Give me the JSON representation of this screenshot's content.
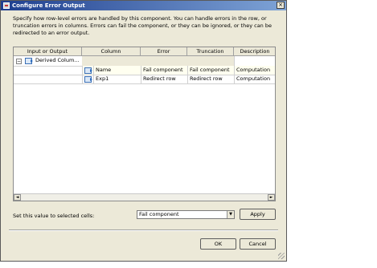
{
  "window": {
    "title": "Configure Error Output",
    "close_glyph": "×"
  },
  "description": "Specify how row-level errors are handled by this component. You can handle errors in the row, or truncation errors in columns. Errors can fail the component, or they can be ignored, or they can be redirected to an error output.",
  "grid": {
    "columns": [
      "Input or Output",
      "Column",
      "Error",
      "Truncation",
      "Description"
    ],
    "parent_row": {
      "expander": "−",
      "label": "Derived Colum..."
    },
    "rows": [
      {
        "column": "Name",
        "error": "Fail component",
        "truncation": "Fail component",
        "description": "Computation"
      },
      {
        "column": "Exp1",
        "error": "Redirect row",
        "truncation": "Redirect row",
        "description": "Computation"
      }
    ],
    "scroll_left": "◄",
    "scroll_right": "►"
  },
  "set_value": {
    "label": "Set this value to selected cells:",
    "selected": "Fail component",
    "arrow": "▼",
    "apply_label": "Apply"
  },
  "footer": {
    "ok_label": "OK",
    "cancel_label": "Cancel"
  },
  "colors": {
    "title_gradient_start": "#1f3f8f",
    "title_gradient_end": "#7ea3d6",
    "dialog_bg": "#ece9d8",
    "highlight_row": "#fffff0"
  },
  "icons": [
    "dialog-icon",
    "component-icon",
    "column-icon",
    "grip-icon"
  ]
}
